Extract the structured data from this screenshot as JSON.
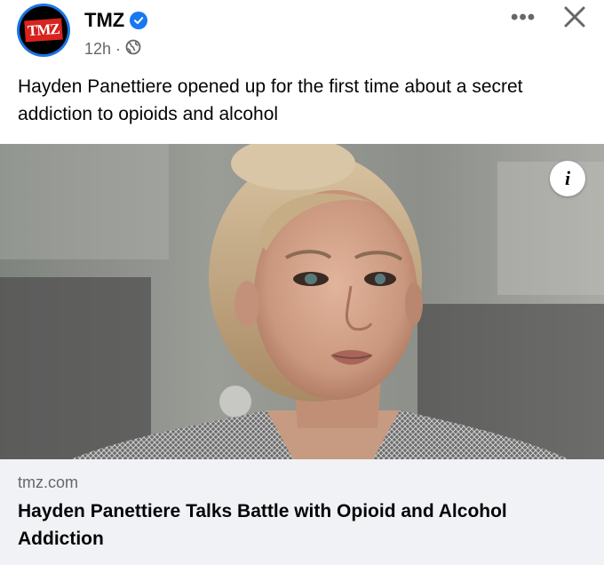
{
  "post": {
    "page_name": "TMZ",
    "logo_text": "TMZ",
    "time": "12h",
    "separator": "·",
    "caption": "Hayden Panettiere opened up for the first time about a secret addiction to opioids and alcohol",
    "more_label": "•••",
    "info_label": "i"
  },
  "link_preview": {
    "domain": "tmz.com",
    "title": "Hayden Panettiere Talks Battle with Opioid and Alcohol Addiction"
  },
  "colors": {
    "verified": "#1877f2",
    "meta_gray": "#65676b",
    "card_bg": "#f0f2f5",
    "logo_red": "#d8231f"
  },
  "icons": {
    "verified": "verified-badge-icon",
    "audience": "globe-icon",
    "more": "more-options-icon",
    "close": "close-icon",
    "info": "info-icon"
  }
}
